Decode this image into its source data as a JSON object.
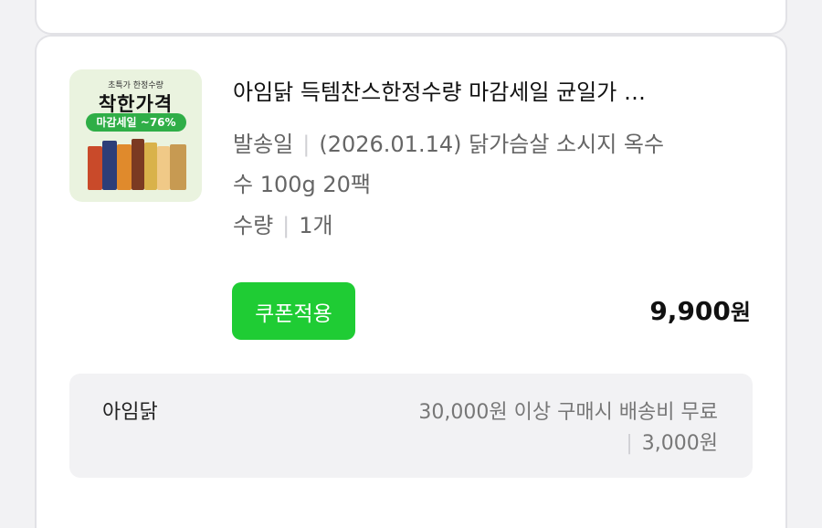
{
  "product": {
    "thumbnail": {
      "top_text": "초특가 한정수량",
      "headline": "착한가격",
      "badge": "마감세일 ~76%"
    },
    "title": "아임닭 득템찬스한정수량 마감세일 균일가 …",
    "options": [
      {
        "label": "발송일",
        "value": "(2026.01.14) 닭가슴살 소시지 옥수"
      },
      {
        "label": "",
        "value": "수 100g 20팩"
      },
      {
        "label": "수량",
        "value": "1개"
      }
    ],
    "coupon_button": "쿠폰적용",
    "price": "9,900",
    "currency": "원"
  },
  "shipping": {
    "seller": "아임닭",
    "condition": "30,000원 이상 구매시 배송비 무료",
    "fee": "3,000원"
  },
  "colors": {
    "accent_green": "#1fcc34",
    "text_primary": "#111111",
    "text_secondary": "#666666",
    "panel_bg": "#f2f2f4"
  }
}
